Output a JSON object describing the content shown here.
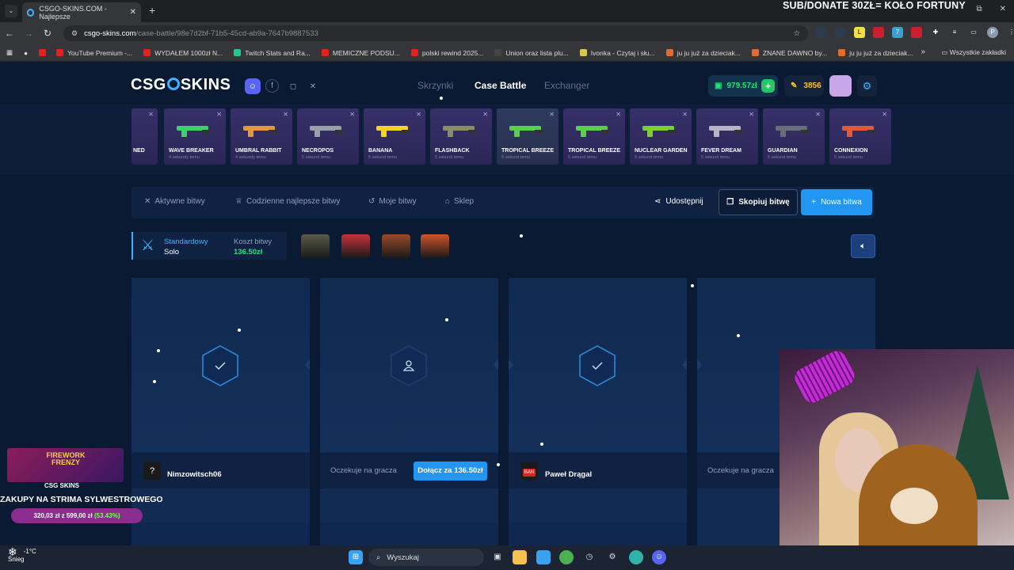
{
  "browser": {
    "tab_title": "CSGO-SKINS.COM - Najlepsze",
    "url_host": "csgo-skins.com",
    "url_path": "/case-battle/98e7d2bf-71b5-45cd-ab9a-7647b9887533",
    "all_bookmarks": "Wszystkie zakładki",
    "bookmarks": [
      {
        "label": "YouTube Premium -...",
        "color": "#e62117"
      },
      {
        "label": "WYDAŁEM 1000zł N...",
        "color": "#e62117"
      },
      {
        "label": "Twitch Stats and Ra...",
        "color": "#27c48e"
      },
      {
        "label": "MEMICZNE PODSU...",
        "color": "#e62117"
      },
      {
        "label": "polski rewind 2025...",
        "color": "#e62117"
      },
      {
        "label": "Union oraz lista plu...",
        "color": "#444"
      },
      {
        "label": "Ivonka - Czytaj i słu...",
        "color": "#d6c74a"
      },
      {
        "label": "ju ju już za dzieciak...",
        "color": "#e86a2a"
      },
      {
        "label": "ZNANE DAWNO by...",
        "color": "#e86a2a"
      },
      {
        "label": "ju ju już za dzieciak...",
        "color": "#e86a2a"
      }
    ]
  },
  "stream_overlay": {
    "top_text": "SUB/DONATE 30ZŁ= KOŁO FORTUNY",
    "promo_title": "FIREWORK FRENZY",
    "promo_brand": "CSG SKINS",
    "promo_text": "ZAKUPY NA STRIMA SYLWESTROWEGO",
    "progress_amount": "320,03 zł z 599,00 zł",
    "progress_percent": "(53.43%)",
    "progress_fraction": 0.5343
  },
  "header": {
    "logo": "CSG SKINS",
    "nav": [
      "Skrzynki",
      "Case Battle",
      "Exchanger"
    ],
    "active_nav": "Case Battle",
    "balance": "979.57zł",
    "coins": "3856"
  },
  "live_drops": [
    {
      "name": "NED",
      "time": "",
      "color": "#c02cff"
    },
    {
      "name": "WAVE BREAKER",
      "time": "4 sekundy temu",
      "color": "#3fd06a"
    },
    {
      "name": "UMBRAL RABBIT",
      "time": "4 sekundy temu",
      "color": "#e09a3a"
    },
    {
      "name": "NECROPOS",
      "time": "5 sekund temu",
      "color": "#9aa0a8"
    },
    {
      "name": "BANANA",
      "time": "5 sekund temu",
      "color": "#f7d12a"
    },
    {
      "name": "FLASHBACK",
      "time": "5 sekund temu",
      "color": "#8a8d6a"
    },
    {
      "name": "TROPICAL BREEZE",
      "time": "5 sekund temu",
      "color": "#5ad04a"
    },
    {
      "name": "TROPICAL BREEZE",
      "time": "5 sekund temu",
      "color": "#5ad04a"
    },
    {
      "name": "NUCLEAR GARDEN",
      "time": "5 sekund temu",
      "color": "#7ad030"
    },
    {
      "name": "FEVER DREAM",
      "time": "5 sekund temu",
      "color": "#b8b4c8"
    },
    {
      "name": "GUARDIAN",
      "time": "5 sekund temu",
      "color": "#6a6e78"
    },
    {
      "name": "CONNEXION",
      "time": "5 sekund temu",
      "color": "#e05a3a"
    }
  ],
  "subnav": {
    "tabs": [
      "Aktywne bitwy",
      "Codzienne najlepsze bitwy",
      "Moje bitwy",
      "Sklep"
    ],
    "share": "Udostępnij",
    "copy": "Skopiuj bitwę",
    "new_battle": "Nowa bitwa"
  },
  "battle": {
    "mode_label": "Standardowy",
    "mode_value": "Solo",
    "cost_label": "Koszt bitwy",
    "cost_value": "136.50zł",
    "cases": [
      "#5b5a4c",
      "#c8323a",
      "#9a4a2a",
      "#d0532a"
    ]
  },
  "slots": [
    {
      "state": "ready",
      "player": "Nimzowitsch06",
      "avatar": "?"
    },
    {
      "state": "waiting",
      "waiting_text": "Oczekuje na gracza",
      "join_label": "Dołącz za 136.50zł"
    },
    {
      "state": "ready",
      "player": "Paweł Drągal",
      "avatar": "BAN"
    },
    {
      "state": "waiting",
      "waiting_text": "Oczekuje na gracza"
    }
  ],
  "taskbar": {
    "weather_temp": "-1°C",
    "weather_desc": "Śnieg",
    "search_placeholder": "Wyszukaj"
  }
}
